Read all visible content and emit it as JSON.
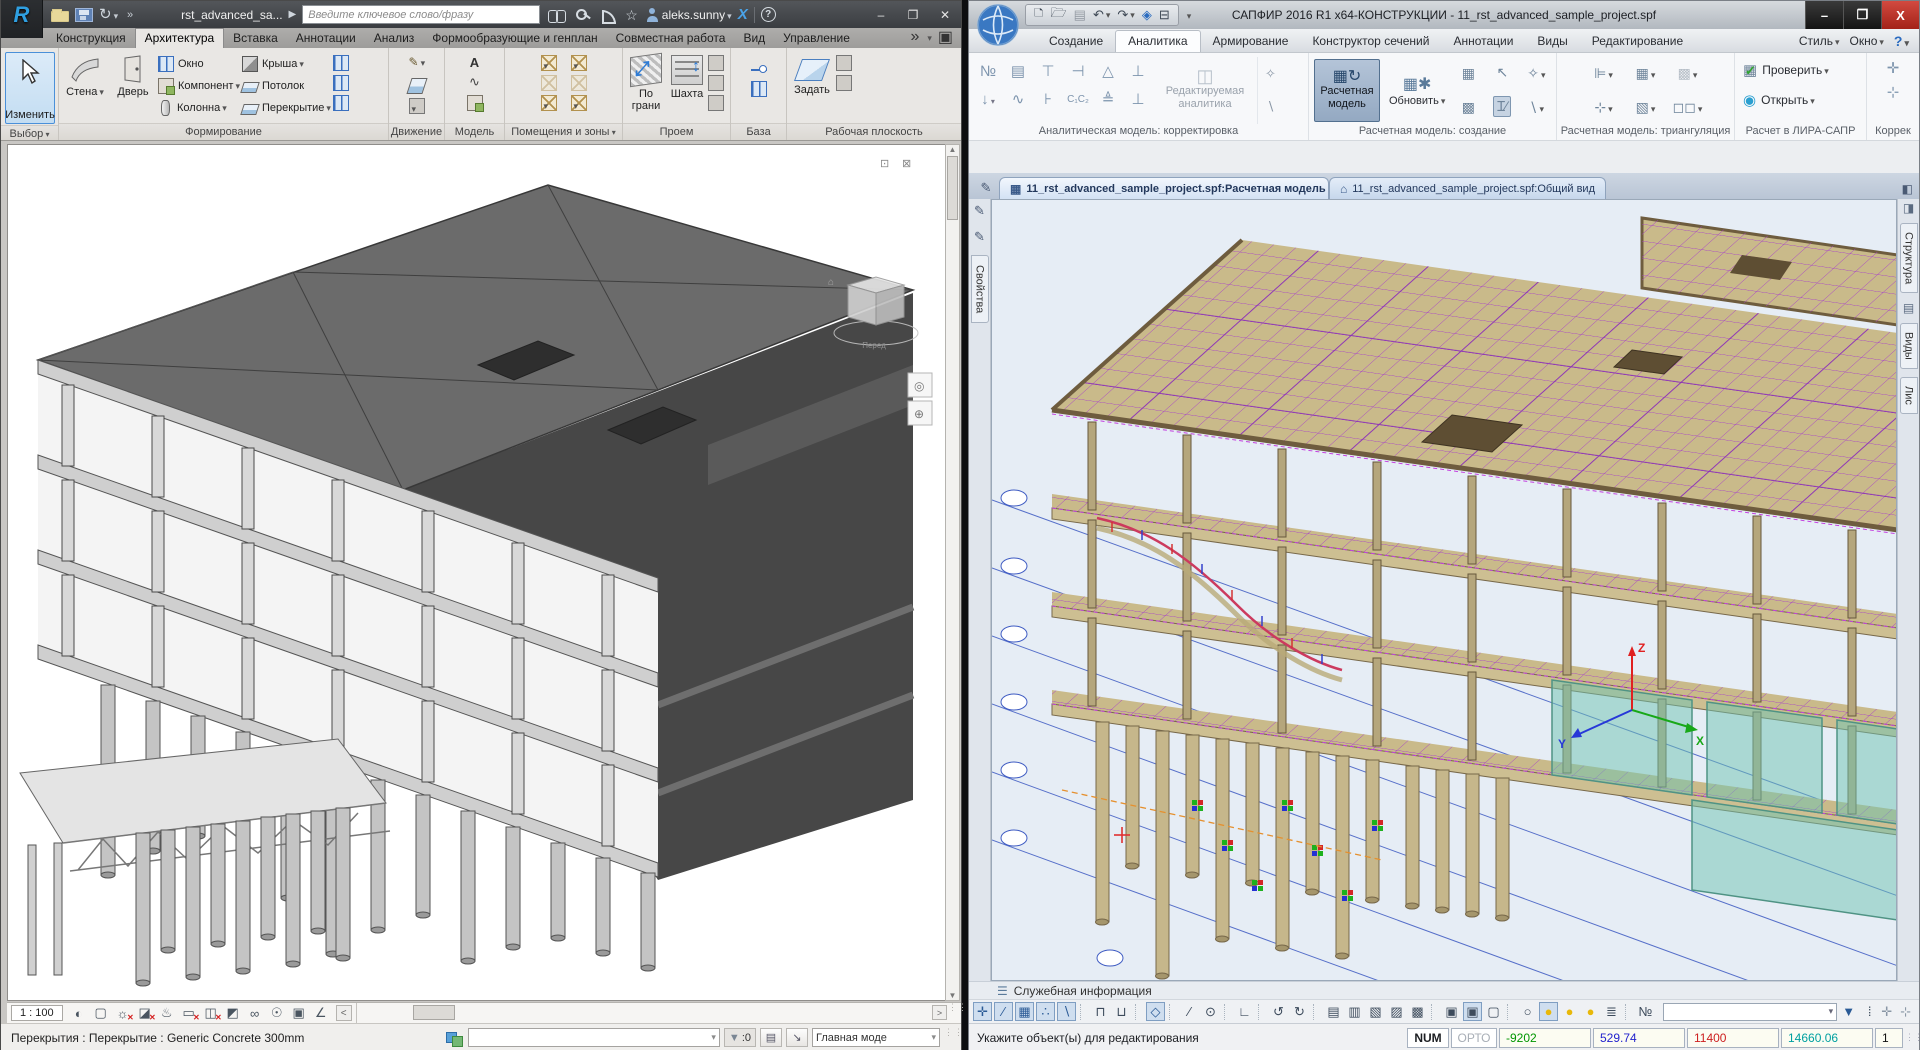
{
  "revit": {
    "titlebar": {
      "title": "rst_advanced_sa...",
      "search_placeholder": "Введите ключевое слово/фразу",
      "user": "aleks.sunny"
    },
    "tabs": [
      {
        "label": "Конструкция"
      },
      {
        "label": "Архитектура",
        "cls": "active"
      },
      {
        "label": "Вставка"
      },
      {
        "label": "Аннотации"
      },
      {
        "label": "Анализ"
      },
      {
        "label": "Формообразующие и генплан"
      },
      {
        "label": "Совместная работа"
      },
      {
        "label": "Вид"
      },
      {
        "label": "Управление"
      }
    ],
    "ribbon": {
      "modify": "Изменить",
      "wall": "Стена",
      "door": "Дверь",
      "window": "Окно",
      "component": "Компонент",
      "column": "Колонна",
      "roof": "Крыша",
      "ceiling": "Потолок",
      "floor": "Перекрытие",
      "by_face": "По грани",
      "shaft": "Шахта",
      "set": "Задать",
      "panels": [
        "Выбор",
        "Формирование",
        "Движение",
        "Модель",
        "Помещения и зоны",
        "Проем",
        "База",
        "Рабочая плоскость"
      ]
    },
    "view": {
      "scale": "1 : 100",
      "controls": [
        {
          "g": "◐",
          "n": "visual-style-icon"
        },
        {
          "g": "▢",
          "n": "detail-level-icon"
        },
        {
          "g": "☼",
          "cls": "off",
          "n": "sun-path-icon"
        },
        {
          "g": "◪",
          "cls": "off",
          "n": "shadows-icon"
        },
        {
          "g": "♨",
          "n": "render-icon"
        },
        {
          "g": "▭",
          "cls": "off",
          "n": "crop-view-icon"
        },
        {
          "g": "◫",
          "cls": "off",
          "n": "show-crop-icon"
        },
        {
          "g": "◩",
          "n": "unlock-view-icon"
        },
        {
          "g": "∞",
          "n": "temporary-hide-icon"
        },
        {
          "g": "☉",
          "n": "reveal-hidden-icon"
        },
        {
          "g": "▣",
          "n": "displacement-icon"
        },
        {
          "g": "∠",
          "n": "constraints-icon"
        }
      ]
    },
    "statusbar": {
      "message": "Перекрытия : Перекрытие : Generic Concrete 300mm",
      "filter_count": ":0",
      "view_combo": "Главная моде"
    }
  },
  "sapfir": {
    "titlebar": {
      "title": "САПФИР 2016 R1 x64-КОНСТРУКЦИИ - 11_rst_advanced_sample_project.spf"
    },
    "tabs": [
      {
        "label": "Создание"
      },
      {
        "label": "Аналитика",
        "cls": "active"
      },
      {
        "label": "Армирование"
      },
      {
        "label": "Конструктор сечений"
      },
      {
        "label": "Аннотации"
      },
      {
        "label": "Виды"
      },
      {
        "label": "Редактирование"
      }
    ],
    "menu_right": {
      "style": "Стиль",
      "window": "Окно",
      "help": "?"
    },
    "ribbon": {
      "amodel_icons": [
        {
          "g": "№",
          "n": "numbering-icon"
        },
        {
          "g": "▤",
          "n": "stack-icon"
        },
        {
          "g": "⊤",
          "n": "pin-support-icon"
        },
        {
          "g": "⊣",
          "n": "edge-support-icon"
        },
        {
          "g": "△",
          "n": "truss-support-icon"
        },
        {
          "g": "⊥",
          "n": "column-support-icon"
        },
        {
          "g": "↓",
          "cls": "car",
          "n": "load-icon"
        },
        {
          "g": "∿",
          "n": "spring-wall-icon"
        },
        {
          "g": "⊦",
          "n": "pier-support-icon"
        },
        {
          "g": "C₁C₂",
          "cls": "sml",
          "n": "bedding-coeff-icon"
        },
        {
          "g": "≜",
          "n": "small-truss-icon"
        },
        {
          "g": "⊥",
          "n": "pier-icon"
        }
      ],
      "editable_analytics": "Редактируемая аналитика",
      "calc_model": "Расчетная модель",
      "update": "Обновить",
      "check": "Проверить",
      "open": "Открыть",
      "captions": [
        "Аналитическая модель: корректировка",
        "Расчетная модель: создание",
        "Расчетная модель: триангуляция",
        "Расчет в ЛИРА-САПР",
        "Коррек"
      ]
    },
    "doc_tabs": {
      "tab1": "11_rst_advanced_sample_project.spf:Расчетная модель",
      "tab2": "11_rst_advanced_sample_project.spf:Общий вид"
    },
    "panels": {
      "left": "Свойства",
      "right": [
        "Структура",
        "Виды",
        "Лис"
      ]
    },
    "info_bar": "Служебная информация",
    "toolbar": [
      {
        "g": "✛",
        "cls": "tgl",
        "n": "snap-point-icon"
      },
      {
        "g": "∕",
        "cls": "tgl",
        "n": "snap-line-icon"
      },
      {
        "g": "▦",
        "cls": "tgl",
        "n": "snap-grid-icon"
      },
      {
        "g": "∴",
        "cls": "tgl",
        "n": "snap-node-icon"
      },
      {
        "g": "∖",
        "cls": "tgl",
        "n": "snap-angle-icon"
      },
      {
        "cls": "sep"
      },
      {
        "g": "⊓",
        "n": "lock-icon"
      },
      {
        "g": "⊔",
        "n": "unlock-icon"
      },
      {
        "cls": "sep"
      },
      {
        "g": "◇",
        "cls": "tgl",
        "n": "workplane-icon"
      },
      {
        "cls": "sep"
      },
      {
        "g": "∕",
        "n": "segment-icon"
      },
      {
        "g": "⊙",
        "n": "circle-icon"
      },
      {
        "cls": "sep"
      },
      {
        "g": "∟",
        "n": "perpendicular-icon"
      },
      {
        "cls": "sep"
      },
      {
        "g": "↺",
        "n": "rotate-ccw-icon"
      },
      {
        "g": "↻",
        "n": "rotate-cw-icon"
      },
      {
        "cls": "sep"
      },
      {
        "g": "▤",
        "n": "view-front-icon"
      },
      {
        "g": "▥",
        "n": "view-side-icon"
      },
      {
        "g": "▧",
        "n": "view-iso-icon"
      },
      {
        "g": "▨",
        "n": "view-back-icon"
      },
      {
        "g": "▩",
        "n": "view-plan-icon"
      },
      {
        "cls": "sep"
      },
      {
        "g": "▣",
        "n": "model-mode-icon"
      },
      {
        "g": "▣",
        "cls": "sel",
        "n": "analytic-mode-icon"
      },
      {
        "g": "▢",
        "n": "wire-mode-icon"
      },
      {
        "cls": "sep"
      },
      {
        "g": "○",
        "n": "bulb-off-icon"
      },
      {
        "g": "●",
        "cls": "bulb tgl",
        "n": "bulb-on-icon"
      },
      {
        "g": "●",
        "cls": "bulb",
        "n": "bulb-layer-icon"
      },
      {
        "g": "●",
        "cls": "bulb",
        "n": "bulb-object-icon"
      },
      {
        "g": "≣",
        "n": "layers-icon"
      },
      {
        "cls": "sep"
      },
      {
        "g": "№",
        "n": "hide-numbers-icon"
      }
    ],
    "statusbar": {
      "message": "Укажите объект(ы) для редактирования",
      "num": "NUM",
      "orto": "ОРТО",
      "coords": [
        {
          "v": "-9202",
          "cls": "c-green"
        },
        {
          "v": "529.74",
          "cls": "c-blue"
        },
        {
          "v": "11400",
          "cls": "c-red"
        },
        {
          "v": "14660.06",
          "cls": "c-teal"
        },
        {
          "v": "1",
          "cls": "c-black"
        }
      ]
    }
  }
}
